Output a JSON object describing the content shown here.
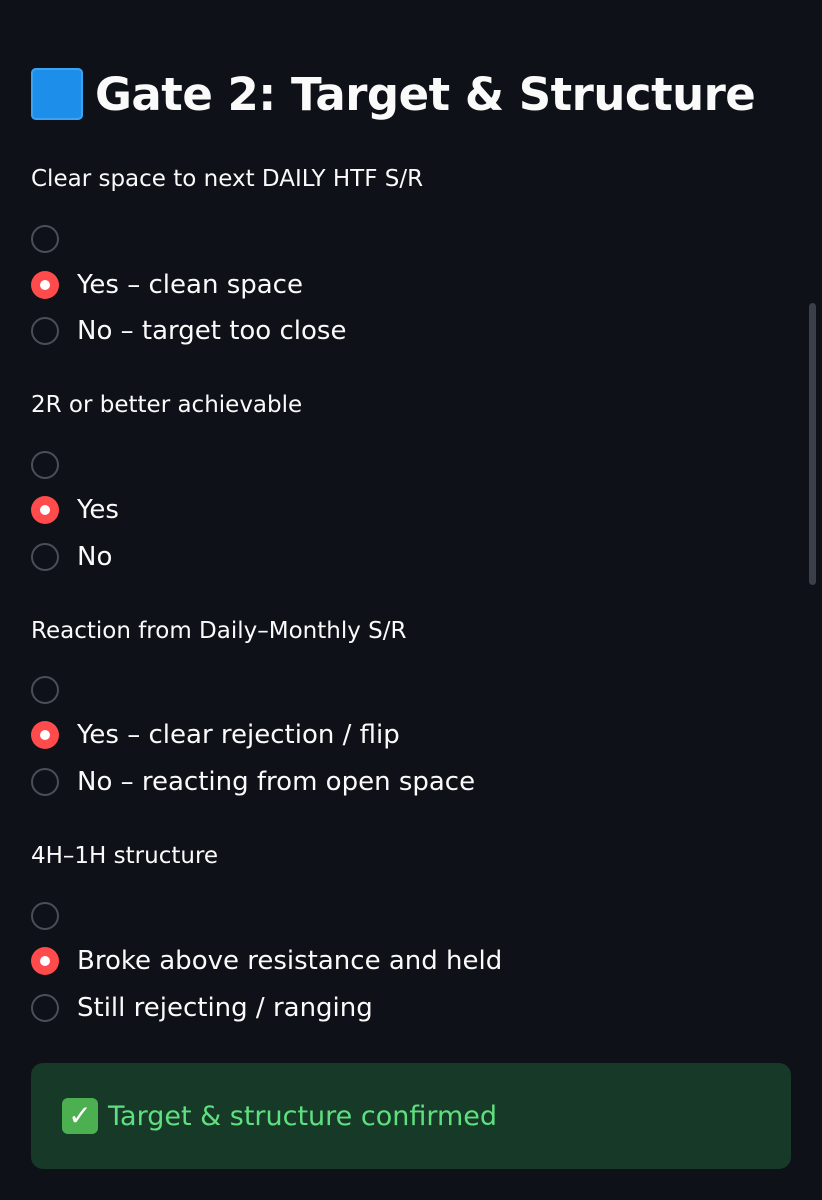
{
  "title": {
    "text": "Gate 2: Target & Structure",
    "icon": "blue-square-icon"
  },
  "questions": [
    {
      "label": "Clear space to next DAILY HTF S/R",
      "options": [
        "",
        "Yes – clean space",
        "No – target too close"
      ],
      "selected_index": 1
    },
    {
      "label": "2R or better achievable",
      "options": [
        "",
        "Yes",
        "No"
      ],
      "selected_index": 1
    },
    {
      "label": "Reaction from Daily–Monthly S/R",
      "options": [
        "",
        "Yes – clear rejection / flip",
        "No – reacting from open space"
      ],
      "selected_index": 1
    },
    {
      "label": "4H–1H structure",
      "options": [
        "",
        "Broke above resistance and held",
        "Still rejecting / ranging"
      ],
      "selected_index": 1
    }
  ],
  "success": {
    "icon": "check-mark-icon",
    "text": "Target & structure confirmed"
  },
  "colors": {
    "background": "#0e1117",
    "accent": "#ff4b4b",
    "success_bg": "#173928",
    "success_text": "#5ee07f",
    "title_square": "#1d8fea"
  }
}
